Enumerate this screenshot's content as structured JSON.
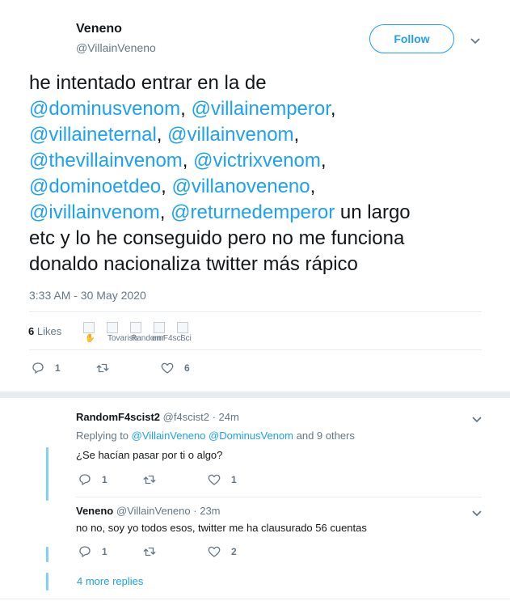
{
  "tweet": {
    "author_name": "Veneno",
    "author_handle": "@VillainVeneno",
    "follow_label": "Follow",
    "text_lines": [
      [
        {
          "t": "he intentado entrar en la de",
          "m": false
        }
      ],
      [
        {
          "t": "@dominusvenom",
          "m": true
        },
        {
          "t": ", ",
          "m": false
        },
        {
          "t": "@villainemperor",
          "m": true
        },
        {
          "t": ",",
          "m": false
        }
      ],
      [
        {
          "t": "@villaineternal",
          "m": true
        },
        {
          "t": ", ",
          "m": false
        },
        {
          "t": "@villainvenom",
          "m": true
        },
        {
          "t": ",",
          "m": false
        }
      ],
      [
        {
          "t": "@thevillainvenom",
          "m": true
        },
        {
          "t": ", ",
          "m": false
        },
        {
          "t": "@victrixvenom",
          "m": true
        },
        {
          "t": ",",
          "m": false
        }
      ],
      [
        {
          "t": "@dominoetdeo",
          "m": true
        },
        {
          "t": ", ",
          "m": false
        },
        {
          "t": "@villanoveneno",
          "m": true
        },
        {
          "t": ",",
          "m": false
        }
      ],
      [
        {
          "t": "@ivillainvenom",
          "m": true
        },
        {
          "t": ", ",
          "m": false
        },
        {
          "t": "@returnedemperor",
          "m": true
        },
        {
          "t": " un largo",
          "m": false
        }
      ],
      [
        {
          "t": "etc y lo he conseguido pero no me funciona",
          "m": false
        }
      ],
      [
        {
          "t": "donaldo nacionaliza twitter más rápico",
          "m": false
        }
      ]
    ],
    "timestamp": "3:33 AM - 30 May 2020",
    "likes_count": "6",
    "likes_label": "Likes",
    "likers": [
      "",
      "Tovarish",
      "Randomr",
      "emF4sci",
      "Sci"
    ],
    "actions": {
      "reply_count": "1",
      "retweet_count": "",
      "like_count": "6"
    }
  },
  "replies": [
    {
      "author_name": "RandomF4scist2",
      "author_handle": "@f4scist2",
      "time": "24m",
      "replying_prefix": "Replying to ",
      "replying_users": [
        "@VillainVeneno",
        "@DominusVenom"
      ],
      "replying_suffix": " and 9 others",
      "text": "¿Se hacían pasar por ti o algo?",
      "reply_count": "1",
      "retweet_count": "",
      "like_count": "1"
    },
    {
      "author_name": "Veneno",
      "author_handle": "@VillainVeneno",
      "time": "23m",
      "text": "no no, soy yo todos esos, twitter me ha clausurado 56 cuentas",
      "reply_count": "1",
      "retweet_count": "",
      "like_count": "2"
    }
  ],
  "more_replies_label": "4 more replies",
  "separator": "·",
  "colors": {
    "accent": "#1da1f2",
    "muted": "#657786",
    "text": "#14171a",
    "divider": "#e6ecf0",
    "thread": "#80d0f8"
  }
}
